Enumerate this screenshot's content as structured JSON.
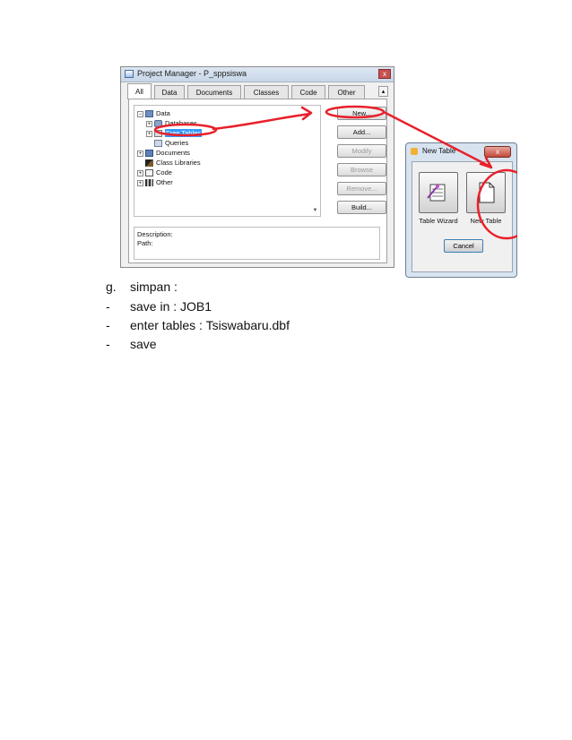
{
  "project_manager": {
    "title": "Project Manager - P_sppsiswa",
    "close": "x",
    "tabs": [
      "All",
      "Data",
      "Documents",
      "Classes",
      "Code",
      "Other"
    ],
    "tab_more": "▴",
    "tree": {
      "data": "Data",
      "databases": "Databases",
      "free_tables": "Free Tables",
      "queries": "Queries",
      "documents": "Documents",
      "class_libraries": "Class Libraries",
      "code": "Code",
      "other": "Other",
      "expand": "+",
      "collapse": "−"
    },
    "buttons": {
      "new": "New...",
      "add": "Add...",
      "modify": "Modify",
      "browse": "Browse",
      "remove": "Remove...",
      "build": "Build..."
    },
    "description_label": "Description:",
    "path_label": "Path:"
  },
  "new_table": {
    "title": "New Table",
    "close": "x",
    "table_wizard": "Table Wizard",
    "new_table": "New Table",
    "cancel": "Cancel"
  },
  "doc": {
    "g_marker": "g.",
    "g_text": "simpan :",
    "dash": "-",
    "step1": "save in : JOB1",
    "step2": "enter tables : Tsiswabaru.dbf",
    "step3": "save"
  },
  "colors": {
    "annotation": "#e8202a",
    "selection": "#3399ff"
  }
}
